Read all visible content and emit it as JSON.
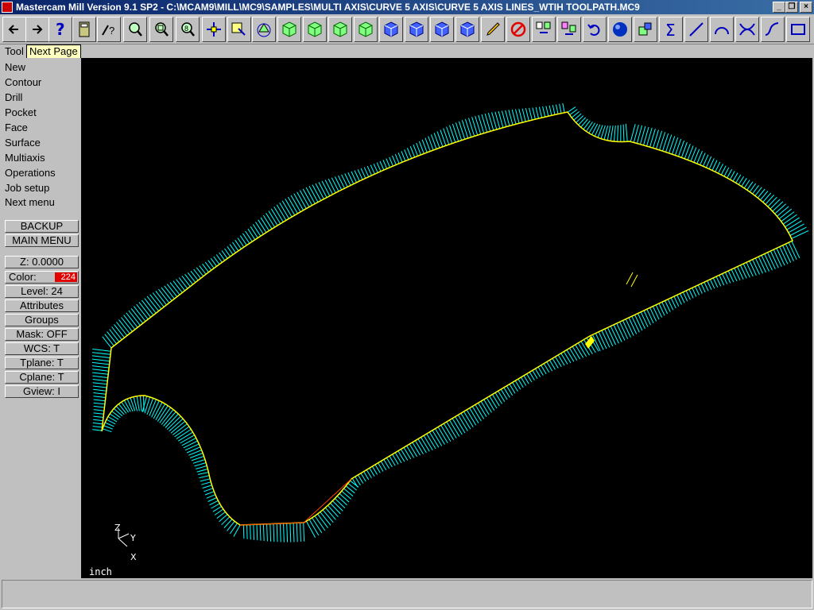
{
  "window": {
    "title": "Mastercam Mill Version 9.1 SP2 - C:\\MCAM9\\MILL\\MC9\\SAMPLES\\MULTI AXIS\\CURVE 5 AXIS\\CURVE 5 AXIS LINES_WTIH TOOLPATH.MC9",
    "minimize_label": "_",
    "restore_label": "❐",
    "close_label": "×"
  },
  "toolbar": {
    "buttons": [
      "back-arrow-icon",
      "forward-arrow-icon",
      "help-icon",
      "calculator-icon",
      "analyze-icon",
      "zoom-window-icon",
      "zoom-fit-icon",
      "zoom-unzoom-icon",
      "pan-icon",
      "select-icon",
      "rotate-view-icon",
      "iso-view-icon",
      "top-view-icon",
      "front-view-icon",
      "side-view-icon",
      "cube-view-1-icon",
      "cube-view-2-icon",
      "cube-view-3-icon",
      "cube-view-4-icon",
      "pencil-icon",
      "no-delete-icon",
      "transform-icon",
      "translate-icon",
      "undo-icon",
      "sphere-icon",
      "solid-icon",
      "sum-icon",
      "line-icon",
      "arc-icon",
      "trim-icon",
      "spline-icon",
      "rectangle-icon"
    ]
  },
  "subbar": {
    "tools_label": "Tool",
    "tooltip": "Next Page"
  },
  "menu": {
    "items": [
      "New",
      "Contour",
      "Drill",
      "Pocket",
      "Face",
      "Surface",
      "Multiaxis",
      "Operations",
      "Job setup",
      "Next menu"
    ],
    "backup": "BACKUP",
    "main_menu": "MAIN MENU"
  },
  "status": {
    "z": "Z:  0.0000",
    "color_label": "Color:",
    "color_value": "224",
    "level": "Level: 24",
    "attributes": "Attributes",
    "groups": "Groups",
    "mask": "Mask:  OFF",
    "wcs": "WCS:   T",
    "tplane": "Tplane:  T",
    "cplane": "Cplane:  T",
    "gview": "Gview:   I"
  },
  "viewport": {
    "units": "inch",
    "axis_z": "Z",
    "axis_y": "Y",
    "axis_x": "X",
    "toolpath_color": "#00ffff",
    "curve_color": "#ffff00"
  }
}
